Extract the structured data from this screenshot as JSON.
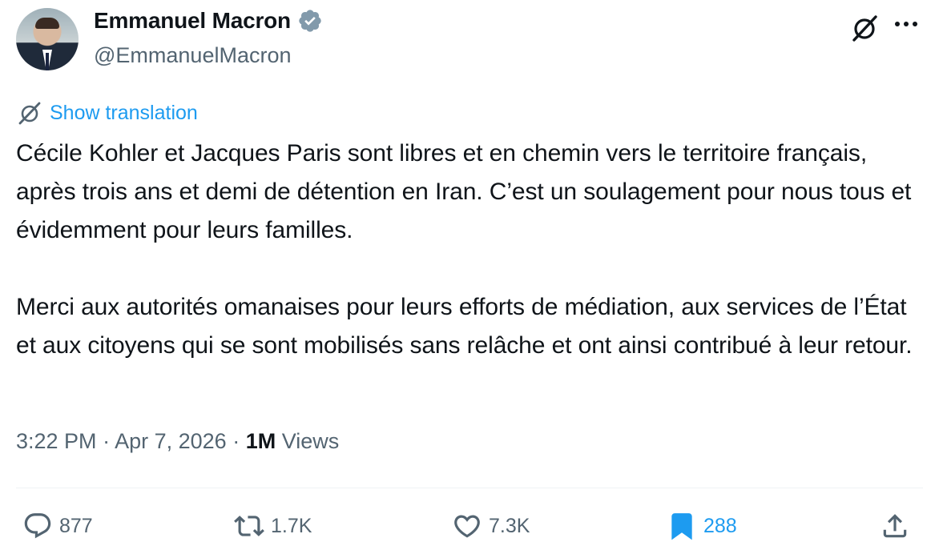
{
  "author": {
    "name": "Emmanuel Macron",
    "handle": "@EmmanuelMacron",
    "verified": true
  },
  "translation": {
    "label": "Show translation"
  },
  "tweet": {
    "paragraphs": [
      "Cécile Kohler et Jacques Paris sont libres et en chemin vers le territoire français, après trois ans et demi de détention en Iran. C’est un soulagement pour nous tous et évidemment pour leurs familles.",
      "Merci aux autorités omanaises pour leurs efforts de médiation, aux services de l’État et aux citoyens qui se sont mobilisés sans relâche et ont ainsi contribué à leur retour."
    ]
  },
  "meta": {
    "time": "3:22 PM",
    "separator": " · ",
    "date": "Apr 7, 2026",
    "views_count": "1M",
    "views_label": "Views"
  },
  "actions": {
    "replies": "877",
    "reposts": "1.7K",
    "likes": "7.3K",
    "bookmarks": "288"
  },
  "icons": {
    "verified": "verified-badge-icon",
    "grok": "grok-icon",
    "more": "more-icon",
    "reply": "reply-icon",
    "repost": "repost-icon",
    "like": "like-icon",
    "bookmark": "bookmark-icon",
    "share": "share-icon"
  },
  "colors": {
    "accent": "#1d9bf0",
    "text": "#0f1419",
    "secondary": "#536471",
    "verified_badge": "#829aab"
  }
}
